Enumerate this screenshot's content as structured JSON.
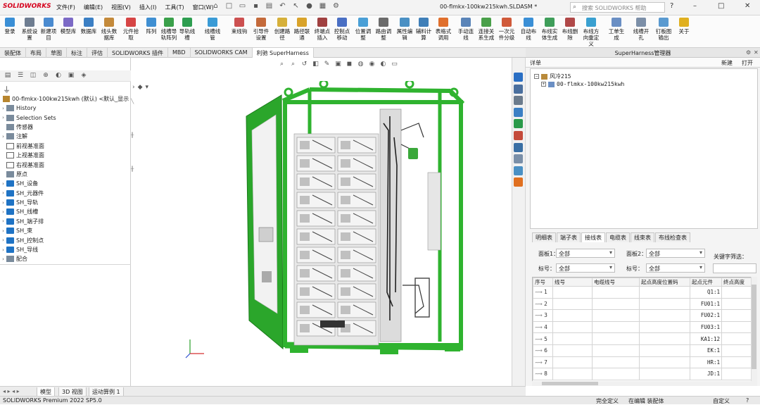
{
  "app": {
    "logo": "SOLIDWORKS",
    "doc_title": "00-flmkx-100kw215kwh.SLDASM *",
    "search_placeholder": "搜索 SOLIDWORKS 帮助",
    "menu": [
      "文件(F)",
      "编辑(E)",
      "视图(V)",
      "插入(I)",
      "工具(T)",
      "窗口(W)"
    ]
  },
  "commands": [
    {
      "label": "登录",
      "color": "#3a8fd6"
    },
    {
      "label": "系统设置",
      "color": "#6e7d91"
    },
    {
      "label": "新建项目",
      "color": "#4a8bd0"
    },
    {
      "label": "模型库",
      "color": "#7c6ac6"
    },
    {
      "label": "数据库",
      "color": "#3b7fc4"
    },
    {
      "label": "线头数据库",
      "color": "#c48a3b"
    },
    {
      "label": "元件拾取",
      "color": "#d64545"
    },
    {
      "label": "阵列",
      "color": "#3f8fd2"
    },
    {
      "label": "线槽导轨阵列",
      "color": "#3aa04a"
    },
    {
      "label": "导轨线槽",
      "color": "#2e9e50"
    },
    {
      "label": "线槽线管",
      "color": "#3a9bd6"
    },
    {
      "label": "束线钩",
      "color": "#cc5050"
    },
    {
      "label": "引导件设置",
      "color": "#c46a3b"
    },
    {
      "label": "创建路径",
      "color": "#d6b03a"
    },
    {
      "label": "路径联通",
      "color": "#d9a32a"
    },
    {
      "label": "终端点插入",
      "color": "#a04040"
    },
    {
      "label": "控制点移动",
      "color": "#4a6fc4"
    },
    {
      "label": "位置调整",
      "color": "#4a9fd6"
    },
    {
      "label": "路由调整",
      "color": "#6b6b6b"
    },
    {
      "label": "属性编辑",
      "color": "#4a90c4"
    },
    {
      "label": "辅料计算",
      "color": "#3f7fb8"
    },
    {
      "label": "表格式调用",
      "color": "#e06f2c"
    },
    {
      "label": "手动连线",
      "color": "#5a84b8"
    },
    {
      "label": "连接关系生成",
      "color": "#4aa04a"
    },
    {
      "label": "一次元件分级",
      "color": "#d05a3a"
    },
    {
      "label": "自动布线",
      "color": "#3a8fd6"
    },
    {
      "label": "布线实体生成",
      "color": "#3f9e5a"
    },
    {
      "label": "布线删除",
      "color": "#b04848"
    },
    {
      "label": "布线方向重定义",
      "color": "#3aa0d0"
    },
    {
      "label": "工单生成",
      "color": "#6a8fc4"
    },
    {
      "label": "线槽开孔",
      "color": "#7c8fa8"
    },
    {
      "label": "钉板图输出",
      "color": "#5a9ad0"
    },
    {
      "label": "关于",
      "color": "#e0b020"
    }
  ],
  "tabs": [
    "装配体",
    "布局",
    "草图",
    "标注",
    "评估",
    "SOLIDWORKS 插件",
    "MBD",
    "SOLIDWORKS CAM",
    "利驰 SuperHarness"
  ],
  "active_tab_index": 8,
  "tree": {
    "root": "00-flmkx-100kw215kwh (默认) <默认_显示",
    "items": [
      {
        "label": "History",
        "arrow": "›",
        "icon": "gen"
      },
      {
        "label": "Selection Sets",
        "arrow": "›",
        "icon": "gen"
      },
      {
        "label": "传感器",
        "arrow": "",
        "icon": "gen"
      },
      {
        "label": "注解",
        "arrow": "›",
        "icon": "gen"
      },
      {
        "label": "前视基准面",
        "arrow": "",
        "icon": "plane"
      },
      {
        "label": "上视基准面",
        "arrow": "",
        "icon": "plane"
      },
      {
        "label": "右视基准面",
        "arrow": "",
        "icon": "plane"
      },
      {
        "label": "原点",
        "arrow": "",
        "icon": "gen"
      },
      {
        "label": "SH_设备",
        "arrow": "›",
        "icon": "folder"
      },
      {
        "label": "SH_元器件",
        "arrow": "›",
        "icon": "folder"
      },
      {
        "label": "SH_导轨",
        "arrow": "›",
        "icon": "folder"
      },
      {
        "label": "SH_线槽",
        "arrow": "›",
        "icon": "folder"
      },
      {
        "label": "SH_端子排",
        "arrow": "›",
        "icon": "folder"
      },
      {
        "label": "SH_束",
        "arrow": "›",
        "icon": "folder"
      },
      {
        "label": "SH_控制点",
        "arrow": "›",
        "icon": "folder"
      },
      {
        "label": "SH_导线",
        "arrow": "›",
        "icon": "folder"
      },
      {
        "label": "配合",
        "arrow": "›",
        "icon": "gen"
      }
    ]
  },
  "superharness": {
    "title": "SuperHarness管理器",
    "tab_left": "详单",
    "btn_new": "新建",
    "btn_open": "打开",
    "tree_root": "风冷215",
    "tree_child": "00-flmkx-100kw215kwh",
    "table_tabs": [
      "明细表",
      "端子表",
      "接线表",
      "电缆表",
      "线束表",
      "布线检查表"
    ],
    "active_table_tab": 2,
    "filters": {
      "panel1_label": "面板1：",
      "panel1_value": "全部",
      "panel2_label": "面板2：",
      "panel2_value": "全部",
      "label1_label": "标号：",
      "label1_value": "全部",
      "label2_label": "标号：",
      "label2_value": "全部",
      "keyword_label": "关键字筛选："
    },
    "columns": [
      "序号",
      "线号",
      "电缆线号",
      "起点高度位置码",
      "起点元件",
      "终点高度"
    ],
    "rows": [
      {
        "n": "1",
        "start": "Q1:1"
      },
      {
        "n": "2",
        "start": "FU01:1"
      },
      {
        "n": "3",
        "start": "FU02:1"
      },
      {
        "n": "4",
        "start": "FU03:1"
      },
      {
        "n": "5",
        "start": "KA1:12"
      },
      {
        "n": "6",
        "start": "EK:1"
      },
      {
        "n": "7",
        "start": "HR:1"
      },
      {
        "n": "8",
        "start": "JD:1"
      }
    ]
  },
  "bottom_tabs": [
    "模型",
    "3D 视图",
    "运动算例 1"
  ],
  "status": {
    "version": "SOLIDWORKS Premium 2022 SP5.0",
    "definition": "完全定义",
    "editing": "在编辑 装配体",
    "custom": "自定义"
  },
  "colors": {
    "frame_green": "#2fb32f",
    "accent_red": "#d5001c"
  }
}
